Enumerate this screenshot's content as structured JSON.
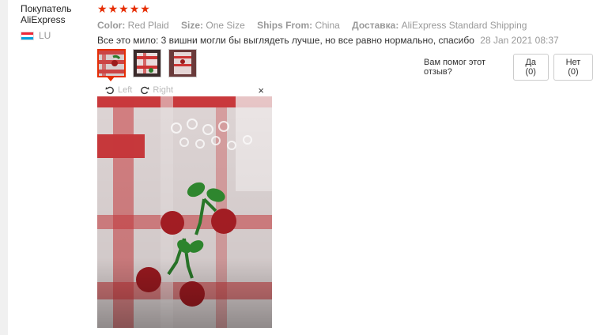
{
  "user": {
    "name": "Покупатель AliExpress",
    "country": "LU"
  },
  "review": {
    "rating": 5,
    "stars": [
      "★",
      "★",
      "★",
      "★",
      "★"
    ],
    "color_label": "Color:",
    "color_value": "Red Plaid",
    "size_label": "Size:",
    "size_value": "One Size",
    "ships_label": "Ships From:",
    "ships_value": "China",
    "delivery_label": "Доставка:",
    "delivery_value": "AliExpress Standard Shipping",
    "text": "Все это мило: 3 вишни могли бы выглядеть лучше, но все равно нормально, спасибо",
    "date": "28 Jan 2021 08:37"
  },
  "helpful": {
    "question": "Вам помог этот отзыв?",
    "yes_label": "Да (0)",
    "no_label": "Нет (0)"
  },
  "viewer": {
    "left_label": "Left",
    "right_label": "Right",
    "close_label": "×"
  },
  "colors": {
    "accent": "#e62e04",
    "muted": "#999999"
  }
}
